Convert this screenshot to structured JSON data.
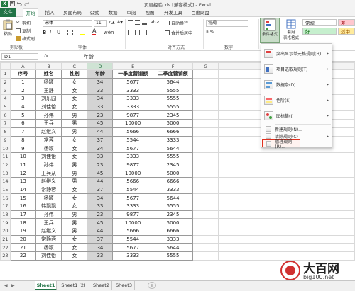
{
  "window": {
    "title": "页眉经验.xls [兼容模式] - Excel"
  },
  "ribbon": {
    "tabs": [
      "文件",
      "开始",
      "插入",
      "页面布局",
      "公式",
      "数据",
      "审阅",
      "视图",
      "开发工具",
      "百度网盘"
    ],
    "active_tab": "开始",
    "clipboard": {
      "cut": "剪切",
      "copy": "复制",
      "format_painter": "格式刷",
      "paste": "粘贴",
      "group": "剪贴板"
    },
    "font": {
      "name": "宋体",
      "size": "11",
      "group": "字体"
    },
    "alignment": {
      "wrap": "自动换行",
      "merge": "合并后居中",
      "group": "对齐方式"
    },
    "number": {
      "format": "常规",
      "group": "数字"
    },
    "styles": {
      "conditional_formatting": "条件格式",
      "table_format_line1": "套用",
      "table_format_line2": "表格格式",
      "style_normal": "常规",
      "style_bad": "差",
      "style_good": "好",
      "style_neutral": "适中"
    }
  },
  "formula_bar": {
    "name_box": "D1",
    "fx": "fx",
    "content": "年龄"
  },
  "grid": {
    "columns": [
      "A",
      "B",
      "C",
      "D",
      "E",
      "F",
      "G"
    ],
    "selected_column": "D",
    "headers": [
      "序号",
      "姓名",
      "性别",
      "年龄",
      "一季度营销额",
      "二季度营销额"
    ],
    "rows": [
      [
        "1",
        "杨颖",
        "女",
        "34",
        "5677",
        "5644"
      ],
      [
        "2",
        "王静",
        "女",
        "33",
        "3333",
        "5555"
      ],
      [
        "3",
        "刘乐园",
        "女",
        "34",
        "3333",
        "5555"
      ],
      [
        "4",
        "刘佳怡",
        "女",
        "33",
        "3333",
        "5555"
      ],
      [
        "5",
        "孙伟",
        "男",
        "23",
        "9877",
        "2345"
      ],
      [
        "6",
        "王兵",
        "男",
        "45",
        "10000",
        "5000"
      ],
      [
        "7",
        "赵继义",
        "男",
        "44",
        "5666",
        "6666"
      ],
      [
        "8",
        "常蓉",
        "女",
        "37",
        "5544",
        "3333"
      ],
      [
        "9",
        "杨颖",
        "女",
        "34",
        "5677",
        "5644"
      ],
      [
        "10",
        "刘佳怡",
        "女",
        "33",
        "3333",
        "5555"
      ],
      [
        "11",
        "孙伟",
        "男",
        "23",
        "9877",
        "2345"
      ],
      [
        "12",
        "王兵从",
        "男",
        "45",
        "10000",
        "5000"
      ],
      [
        "13",
        "赵继义",
        "男",
        "44",
        "5666",
        "6666"
      ],
      [
        "14",
        "常静蓉",
        "女",
        "37",
        "5544",
        "3333"
      ],
      [
        "15",
        "杨颖",
        "女",
        "34",
        "5677",
        "5644"
      ],
      [
        "16",
        "韩飘飘",
        "女",
        "33",
        "3333",
        "5555"
      ],
      [
        "17",
        "孙伟",
        "男",
        "23",
        "9877",
        "2345"
      ],
      [
        "18",
        "王兵",
        "男",
        "45",
        "10000",
        "5000"
      ],
      [
        "19",
        "赵继义",
        "男",
        "44",
        "5666",
        "6666"
      ],
      [
        "20",
        "常静蓉",
        "女",
        "37",
        "5544",
        "3333"
      ],
      [
        "21",
        "杨颖",
        "女",
        "34",
        "5677",
        "5644"
      ],
      [
        "22",
        "刘佳怡",
        "女",
        "33",
        "3333",
        "5555"
      ]
    ]
  },
  "conditional_menu": {
    "items": [
      "突出显示单元格规则(H)",
      "项目选取规则(T)",
      "数据条(D)",
      "色阶(S)",
      "图标集(I)"
    ],
    "new_rule": "新建规则(N)...",
    "clear_rules": "清除规则(C)",
    "manage_rules": "管理规则(R)..."
  },
  "sheets": {
    "tabs": [
      "Sheet1",
      "Sheet1 (2)",
      "Sheet2",
      "Sheet3"
    ],
    "active": "Sheet1",
    "add": "+"
  },
  "watermark": {
    "text": "大百网",
    "url": "big100.net"
  },
  "colors": {
    "excel_green": "#217346",
    "menu_highlight": "#e0301e",
    "selected_column": "#d4d4d4",
    "style_bad_bg": "#ffc7ce",
    "style_good_bg": "#c6efce",
    "style_neutral_bg": "#ffeb9c"
  }
}
